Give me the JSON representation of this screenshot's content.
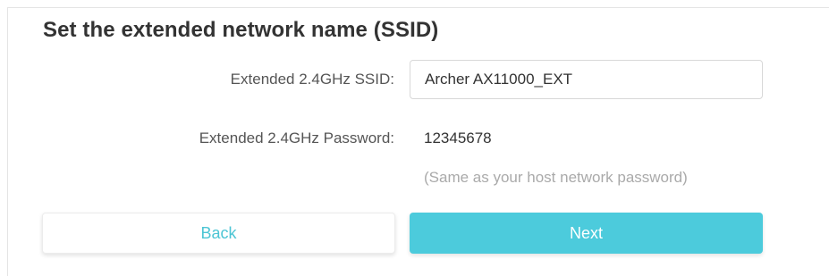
{
  "heading": "Set the extended network name (SSID)",
  "ssid": {
    "label": "Extended 2.4GHz SSID:",
    "value": "Archer AX11000_EXT"
  },
  "password": {
    "label": "Extended 2.4GHz Password:",
    "value": "12345678",
    "hint": "(Same as your host network password)"
  },
  "buttons": {
    "back_label": "Back",
    "next_label": "Next"
  },
  "colors": {
    "accent": "#4ccbdc",
    "back_text": "#4cc5d4"
  }
}
